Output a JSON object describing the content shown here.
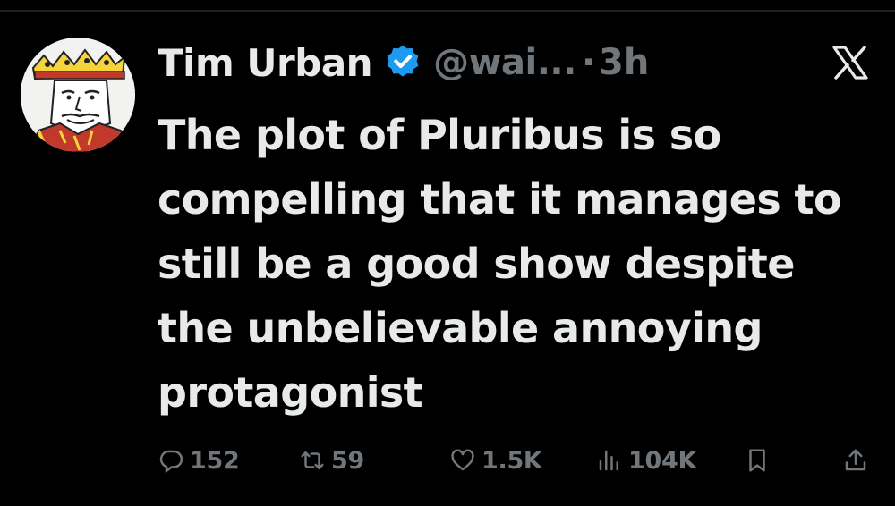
{
  "tweet": {
    "author_name": "Tim Urban",
    "handle": "@wai...",
    "separator": "·",
    "time": "3h",
    "text": "The plot of Pluribus is so compelling that it manages to still be a good show despite the unbelievable annoying protagonist",
    "verified_icon": "verified-badge-icon",
    "platform_icon": "x-logo-icon"
  },
  "actions": {
    "replies": "152",
    "reposts": "59",
    "likes": "1.5K",
    "views": "104K"
  },
  "colors": {
    "background": "#000000",
    "primary_text": "#e7e9ea",
    "secondary_text": "#71767b",
    "verified": "#1d9bf0"
  }
}
